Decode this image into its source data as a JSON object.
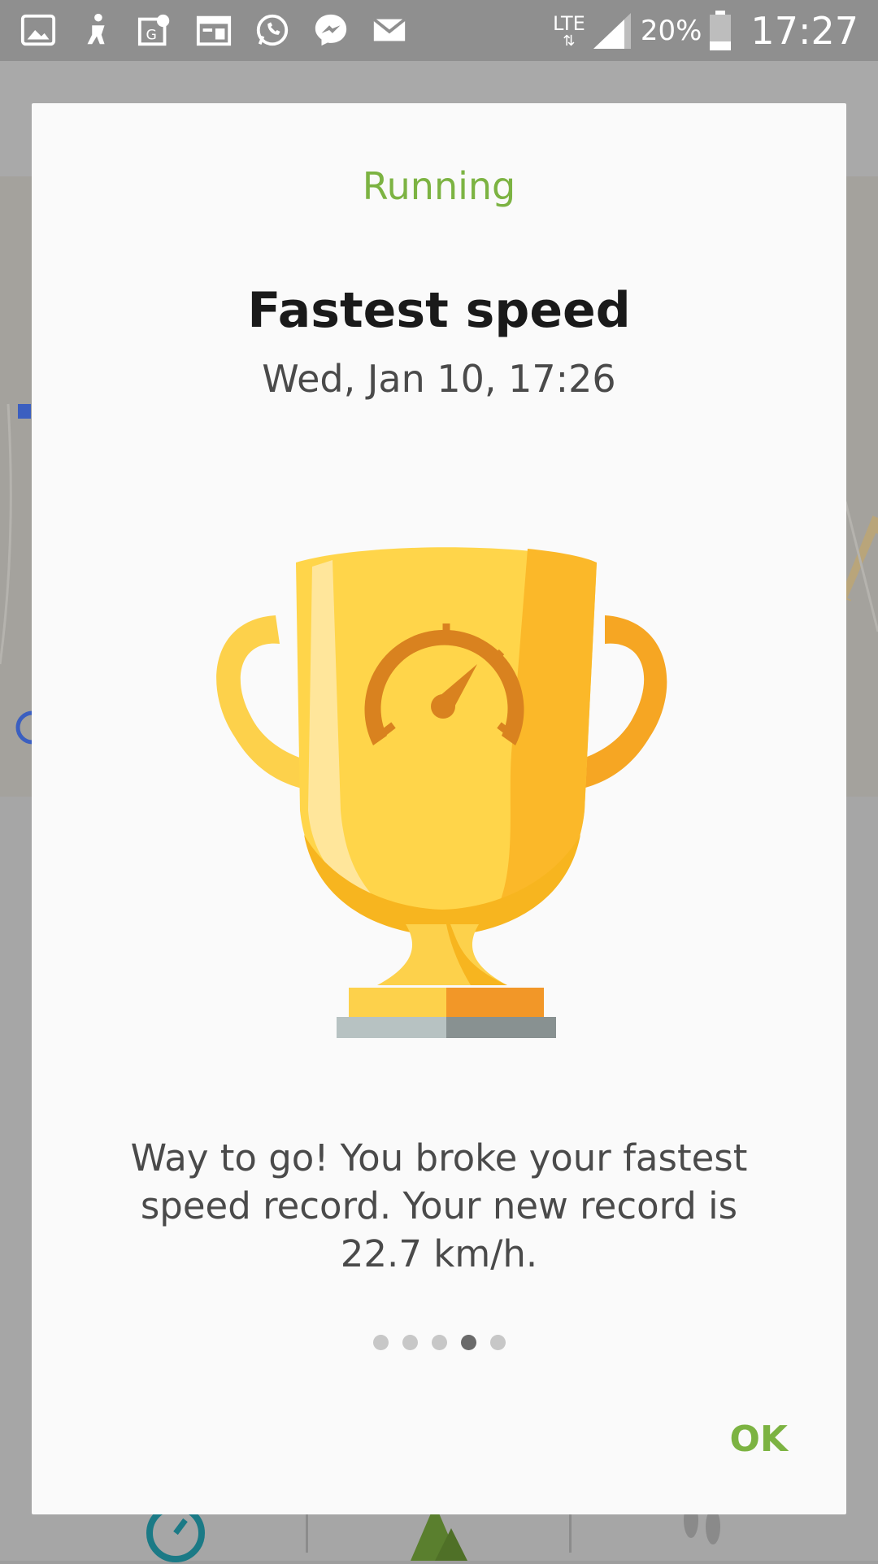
{
  "status_bar": {
    "network": "LTE",
    "battery": "20%",
    "time": "17:27",
    "notification_icons": [
      "gallery-icon",
      "fitness-icon",
      "maps-icon",
      "calendar-icon",
      "whatsapp-icon",
      "messenger-icon",
      "email-icon"
    ]
  },
  "dialog": {
    "category": "Running",
    "title": "Fastest speed",
    "date": "Wed, Jan 10, 17:26",
    "message": "Way to go! You broke your fastest speed record. Your new record is 22.7 km/h.",
    "ok_label": "OK",
    "page_count": 5,
    "active_page": 4,
    "accent_color": "#7cb342"
  }
}
